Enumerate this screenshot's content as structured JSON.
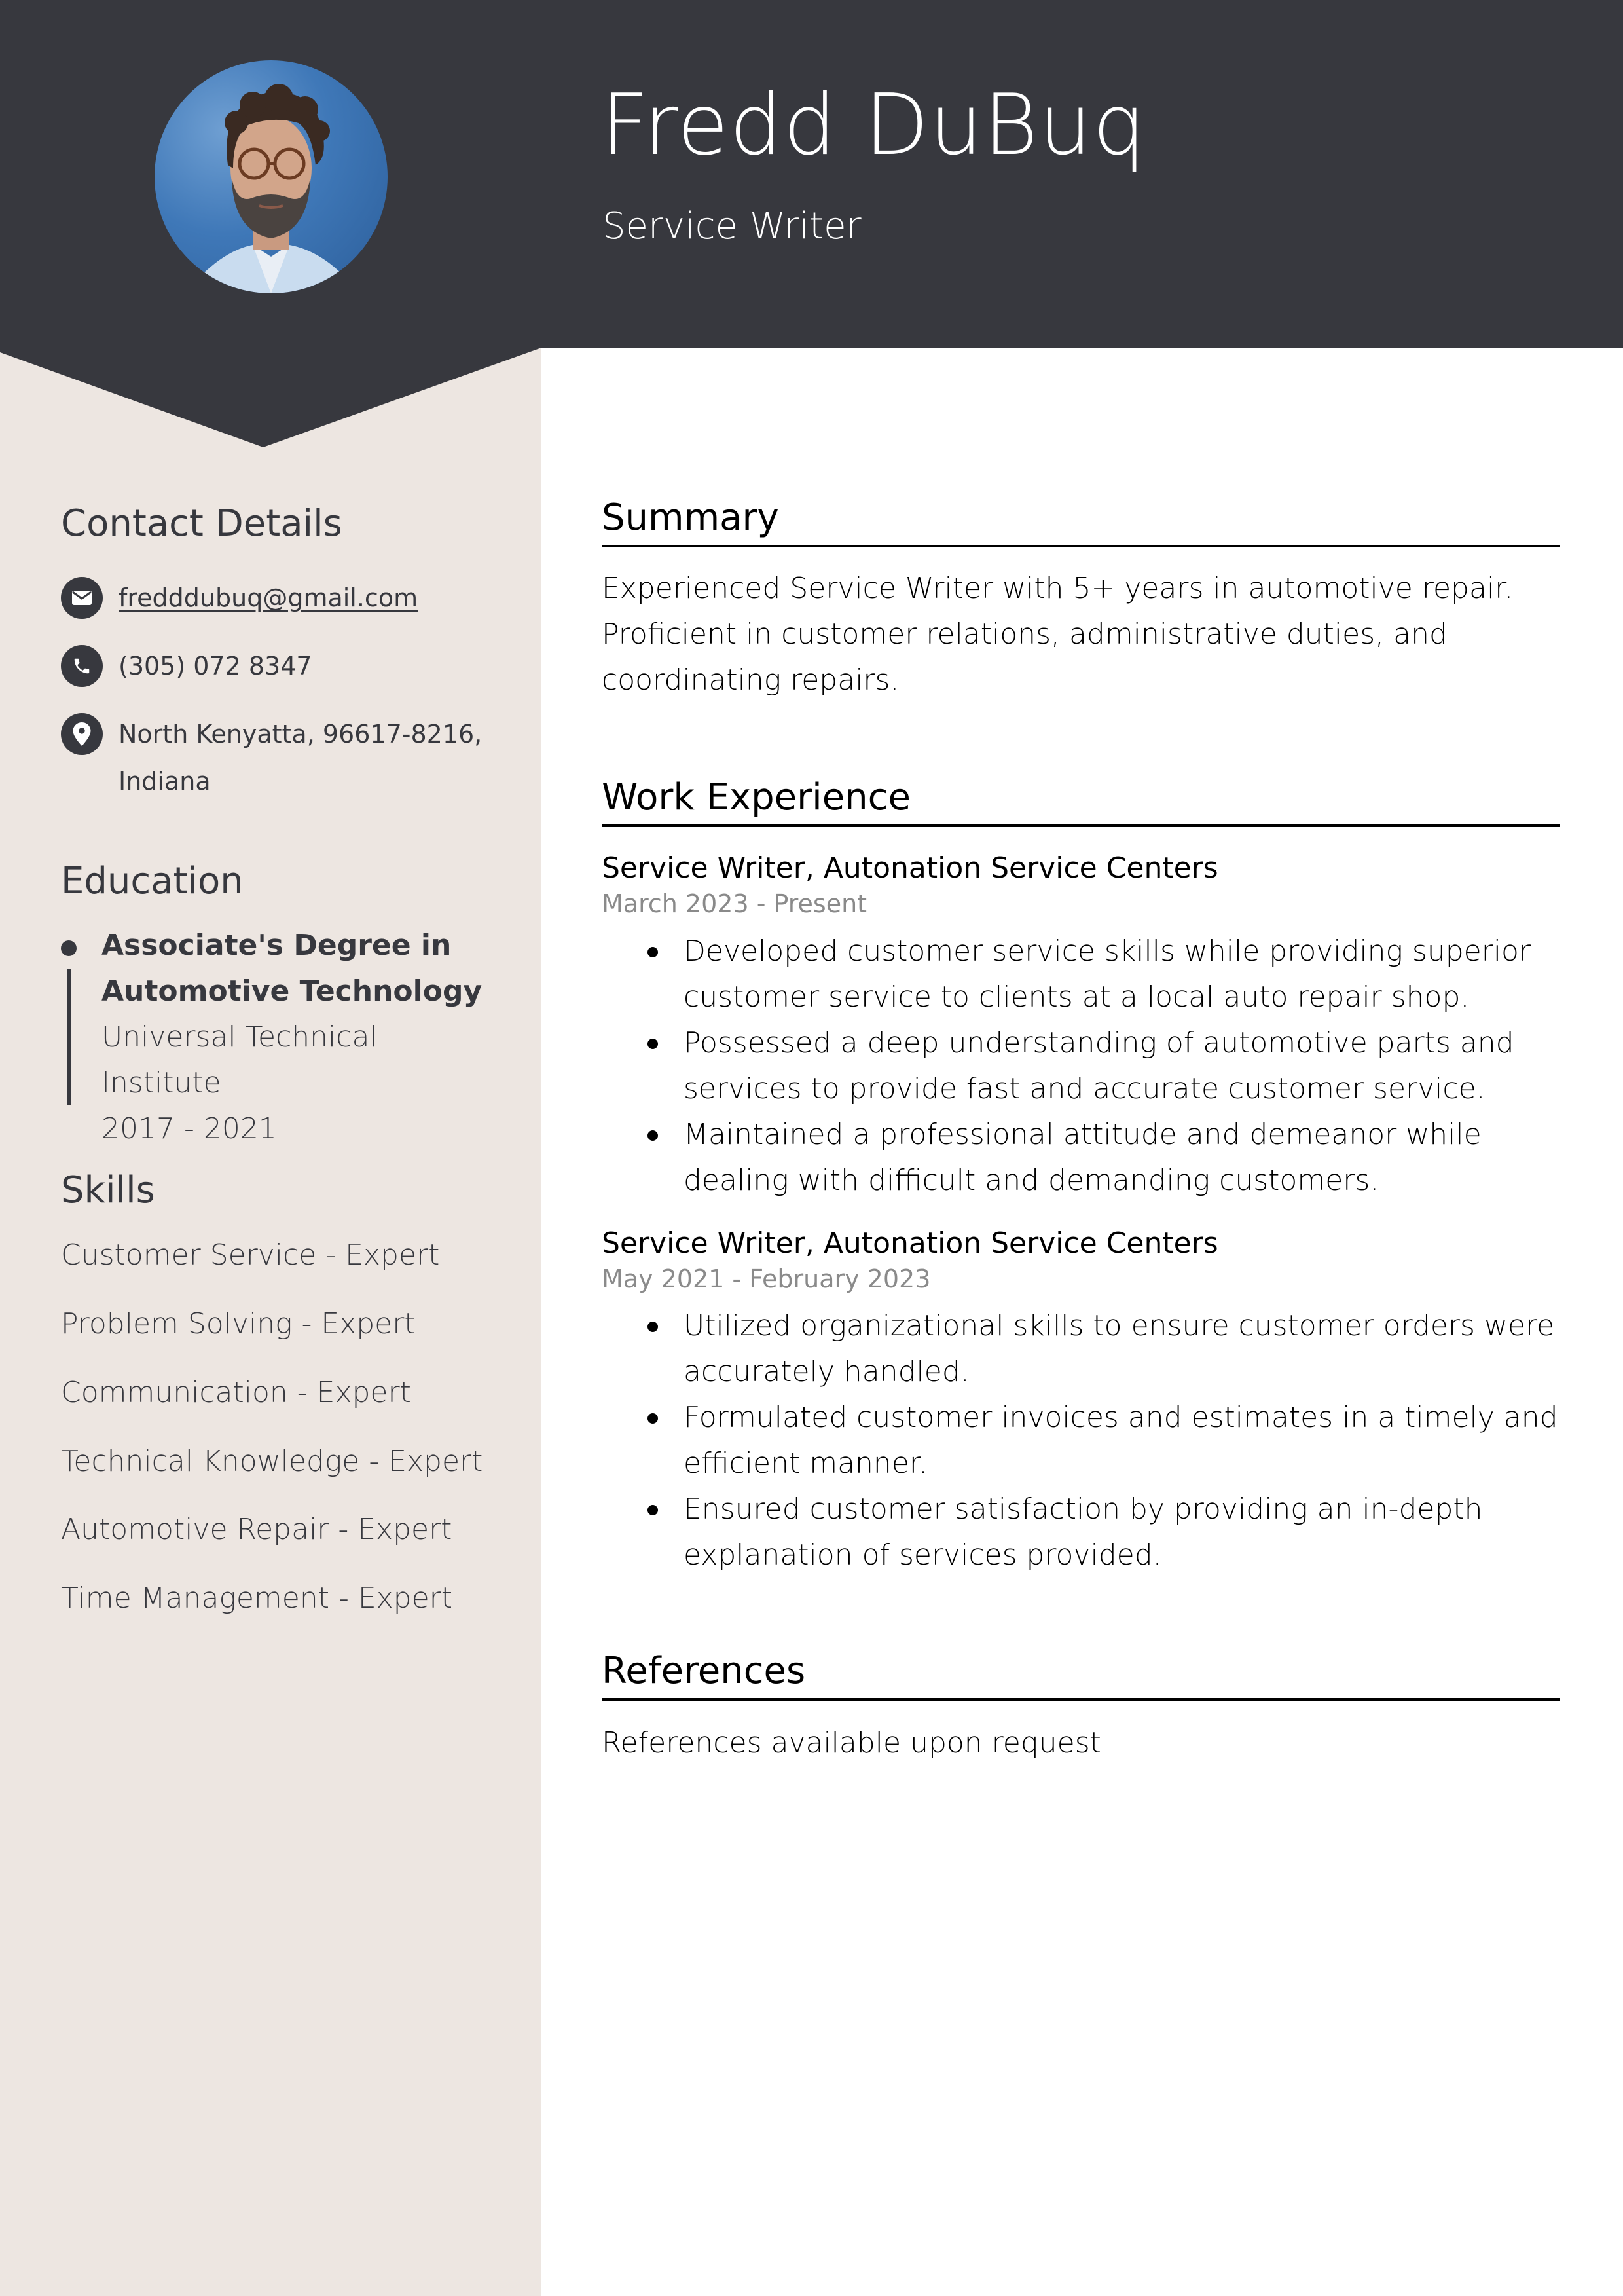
{
  "header": {
    "name": "Fredd DuBuq",
    "title": "Service Writer",
    "photo_alt": "profile-photo"
  },
  "colors": {
    "header_bg": "#37383e",
    "sidebar_bg": "#ede6e1",
    "text_dark": "#37383e",
    "date_gray": "#8a8a8a"
  },
  "sidebar": {
    "contact": {
      "heading": "Contact Details",
      "email": "fredddubuq@gmail.com",
      "phone": "(305) 072 8347",
      "address_line1": "North Kenyatta, 96617-8216,",
      "address_line2": "Indiana",
      "icons": [
        "envelope-icon",
        "phone-icon",
        "location-pin-icon"
      ]
    },
    "education": {
      "heading": "Education",
      "items": [
        {
          "degree_line1": "Associate's Degree in",
          "degree_line2": "Automotive Technology",
          "school": "Universal Technical Institute",
          "years": "2017 - 2021"
        }
      ]
    },
    "skills": {
      "heading": "Skills",
      "items": [
        "Customer Service - Expert",
        "Problem Solving - Expert",
        "Communication - Expert",
        "Technical Knowledge - Expert",
        "Automotive Repair - Expert",
        "Time Management - Expert"
      ]
    }
  },
  "main": {
    "summary": {
      "heading": "Summary",
      "text": "Experienced Service Writer with 5+ years in automotive repair. Proficient in customer relations, administrative duties, and coordinating repairs."
    },
    "work": {
      "heading": "Work Experience",
      "jobs": [
        {
          "title": "Service Writer, Autonation Service Centers",
          "dates": "March 2023 - Present",
          "bullets": [
            "Developed customer service skills while providing superior customer service to clients at a local auto repair shop.",
            "Possessed a deep understanding of automotive parts and services to provide fast and accurate customer service.",
            "Maintained a professional attitude and demeanor while dealing with difficult and demanding customers."
          ]
        },
        {
          "title": "Service Writer, Autonation Service Centers",
          "dates": "May 2021 - February 2023",
          "bullets": [
            "Utilized organizational skills to ensure customer orders were accurately handled.",
            "Formulated customer invoices and estimates in a timely and efficient manner.",
            "Ensured customer satisfaction by providing an in-depth explanation of services provided."
          ]
        }
      ]
    },
    "references": {
      "heading": "References",
      "text": "References available upon request"
    }
  }
}
